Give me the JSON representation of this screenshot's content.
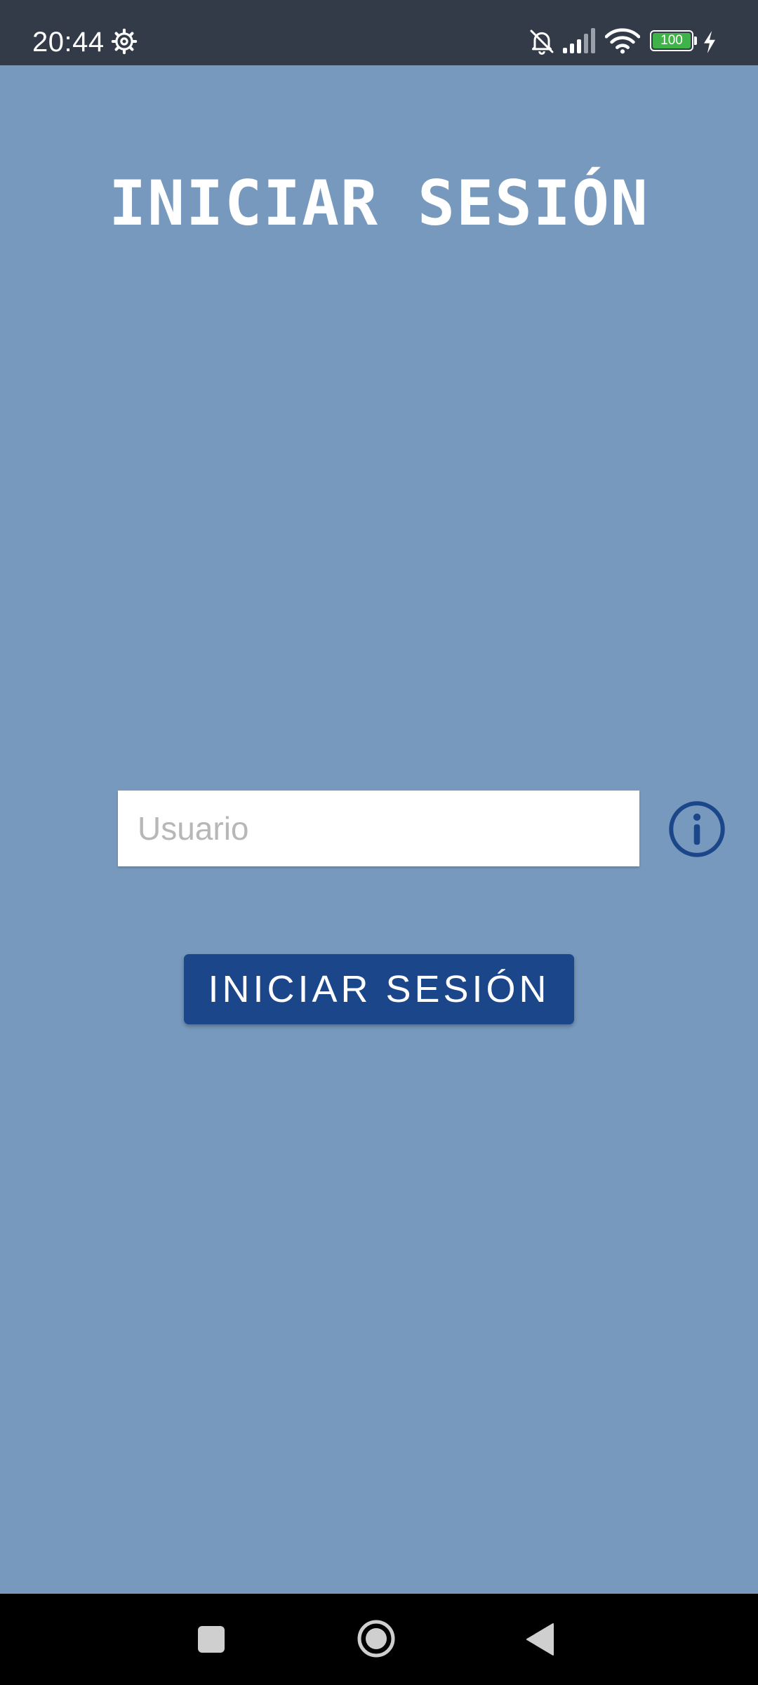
{
  "status_bar": {
    "time": "20:44",
    "battery_level": "100",
    "icons": [
      "gear-icon",
      "bell-off-icon",
      "signal-icon",
      "wifi-icon",
      "battery-icon",
      "charging-icon"
    ]
  },
  "login": {
    "title": "INICIAR SESIÓN",
    "username_placeholder": "Usuario",
    "username_value": "",
    "info_icon": "info-icon",
    "button_label": "INICIAR SESIÓN"
  },
  "nav_bar": {
    "icons": [
      "recents-square-icon",
      "home-circle-icon",
      "back-triangle-icon"
    ]
  },
  "colors": {
    "background": "#7799bd",
    "status_bar": "#333b49",
    "button": "#1b4689",
    "info_icon": "#1b4689",
    "battery": "#3fb34a",
    "nav_bar": "#000000"
  }
}
